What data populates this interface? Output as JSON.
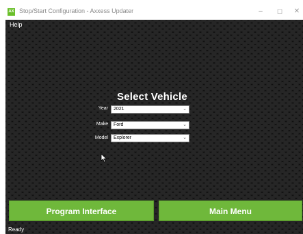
{
  "window": {
    "title": "Stop/Start Configuration - Axxess Updater",
    "icon_label": "AX",
    "controls": {
      "minimize": "–",
      "maximize": "☐",
      "close": "✕"
    }
  },
  "menu": {
    "help": "Help"
  },
  "form": {
    "title": "Select Vehicle",
    "year": {
      "label": "Year",
      "value": "2021"
    },
    "make": {
      "label": "Make",
      "value": "Ford"
    },
    "model": {
      "label": "Model",
      "value": "Explorer"
    },
    "chevron": "⌄"
  },
  "buttons": {
    "program_interface": "Program Interface",
    "main_menu": "Main Menu"
  },
  "status": "Ready",
  "colors": {
    "accent_green": "#6fb83b",
    "background": "#101010"
  }
}
